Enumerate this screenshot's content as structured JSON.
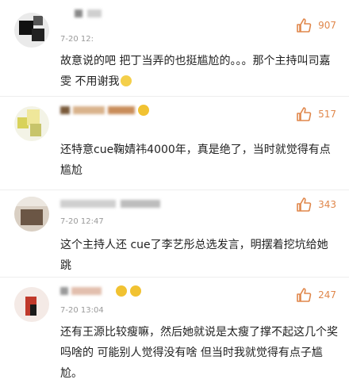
{
  "comments": [
    {
      "timestamp": "7-20 12:",
      "likes": "907",
      "text": "故意说的吧 把丁当弄的也挺尴尬的。。。那个主持叫司嘉雯 不用谢我"
    },
    {
      "timestamp": "",
      "likes": "517",
      "text": "还特意cue鞠婧祎4000年，真是绝了，当时就觉得有点尴尬"
    },
    {
      "timestamp": "7-20 12:47",
      "likes": "343",
      "text": "这个主持人还 cue了李艺彤总选发言，明摆着挖坑给她跳"
    },
    {
      "timestamp": "7-20 13:04",
      "likes": "247",
      "text": "还有王源比较瘦嘛，然后她就说是太瘦了撑不起这几个奖吗啥的 可能别人觉得没有啥 但当时我就觉得有点子尴尬。"
    }
  ],
  "icons": {
    "like": "thumbs-up-icon",
    "emoji": "smiley-emoji-icon"
  },
  "colors": {
    "like_count": "#e0874b",
    "timestamp": "#9a9a9a",
    "text": "#222222"
  }
}
